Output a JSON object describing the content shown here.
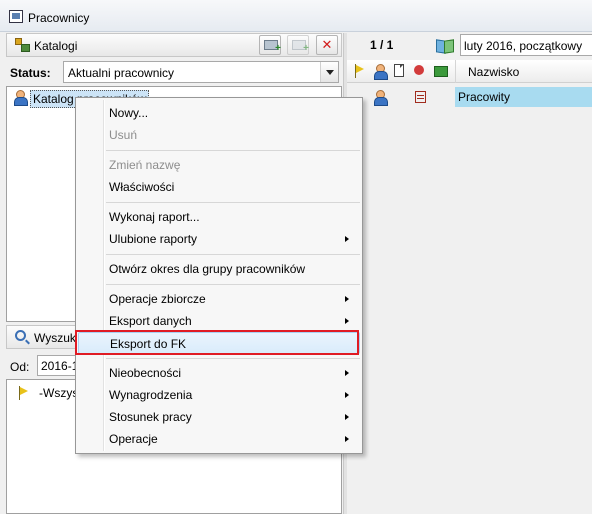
{
  "window": {
    "title": "Pracownicy"
  },
  "left_panel": {
    "header_label": "Katalogi",
    "status_label": "Status:",
    "status_value": "Aktualni pracownicy",
    "tree_item": "Katalog pracowników",
    "search_label": "Wyszukaj",
    "od_label": "Od:",
    "od_value": "2016-1",
    "search_item": "-Wszystkie"
  },
  "right_panel": {
    "page_indicator": "1 / 1",
    "period": "luty 2016, początkowy",
    "column_header": "Nazwisko",
    "rows": [
      {
        "nazwisko": "Pracowity"
      }
    ]
  },
  "context_menu": {
    "items": [
      {
        "label": "Nowy...",
        "disabled": false,
        "submenu": false
      },
      {
        "label": "Usuń",
        "disabled": true,
        "submenu": false
      },
      {
        "label": "Zmień nazwę",
        "disabled": true,
        "submenu": false
      },
      {
        "label": "Właściwości",
        "disabled": false,
        "submenu": false
      },
      {
        "label": "Wykonaj raport...",
        "disabled": false,
        "submenu": false
      },
      {
        "label": "Ulubione raporty",
        "disabled": false,
        "submenu": true
      },
      {
        "label": "Otwórz okres dla grupy pracowników",
        "disabled": false,
        "submenu": false
      },
      {
        "label": "Operacje zbiorcze",
        "disabled": false,
        "submenu": true
      },
      {
        "label": "Eksport danych",
        "disabled": false,
        "submenu": true
      },
      {
        "label": "Eksport do FK",
        "disabled": false,
        "submenu": false,
        "highlighted": true
      },
      {
        "label": "Nieobecności",
        "disabled": false,
        "submenu": true
      },
      {
        "label": "Wynagrodzenia",
        "disabled": false,
        "submenu": true
      },
      {
        "label": "Stosunek pracy",
        "disabled": false,
        "submenu": true
      },
      {
        "label": "Operacje",
        "disabled": false,
        "submenu": true
      }
    ]
  },
  "colors": {
    "highlight_border": "#e01b24",
    "selection": "#a8dbf0",
    "close_button": "#d21c1c"
  }
}
